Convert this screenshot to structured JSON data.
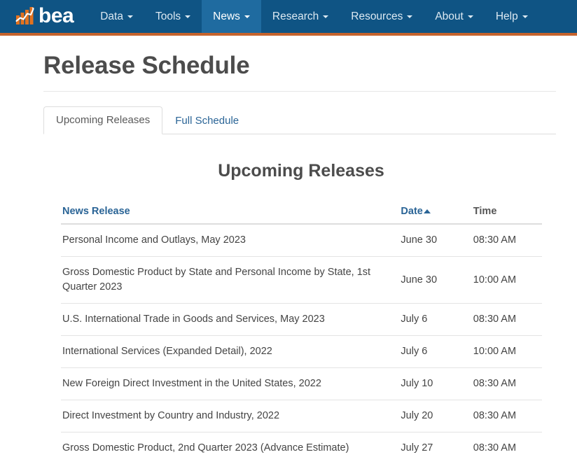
{
  "navbar": {
    "brand": {
      "logo_text": "bea",
      "logo_icon": "bea-bar-chart-logo"
    },
    "items": [
      {
        "label": "Data",
        "has_caret": true,
        "active": false
      },
      {
        "label": "Tools",
        "has_caret": true,
        "active": false
      },
      {
        "label": "News",
        "has_caret": true,
        "active": true
      },
      {
        "label": "Research",
        "has_caret": true,
        "active": false
      },
      {
        "label": "Resources",
        "has_caret": true,
        "active": false
      },
      {
        "label": "About",
        "has_caret": true,
        "active": false
      },
      {
        "label": "Help",
        "has_caret": true,
        "active": false
      }
    ],
    "colors": {
      "background": "#0f5484",
      "active_tab": "#1f6ba0",
      "accent_underline": "#c5632c",
      "link": "#dce9f2"
    }
  },
  "page": {
    "title": "Release Schedule"
  },
  "tabs": [
    {
      "label": "Upcoming Releases",
      "active": true
    },
    {
      "label": "Full Schedule",
      "active": false
    }
  ],
  "section": {
    "title": "Upcoming Releases"
  },
  "table": {
    "columns": {
      "release": "News Release",
      "date": "Date",
      "time": "Time"
    },
    "sort": {
      "column": "Date",
      "direction": "ascending",
      "indicator": "caret-up-icon"
    },
    "rows": [
      {
        "release": "Personal Income and Outlays, May 2023",
        "date": "June 30",
        "time": "08:30 AM"
      },
      {
        "release": "Gross Domestic Product by State and Personal Income by State, 1st Quarter 2023",
        "date": "June 30",
        "time": "10:00 AM"
      },
      {
        "release": "U.S. International Trade in Goods and Services, May 2023",
        "date": "July 6",
        "time": "08:30 AM"
      },
      {
        "release": "International Services (Expanded Detail), 2022",
        "date": "July 6",
        "time": "10:00 AM"
      },
      {
        "release": "New Foreign Direct Investment in the United States, 2022",
        "date": "July 10",
        "time": "08:30 AM"
      },
      {
        "release": "Direct Investment by Country and Industry, 2022",
        "date": "July 20",
        "time": "08:30 AM"
      },
      {
        "release": "Gross Domestic Product, 2nd Quarter 2023 (Advance Estimate)",
        "date": "July 27",
        "time": "08:30 AM"
      }
    ]
  }
}
